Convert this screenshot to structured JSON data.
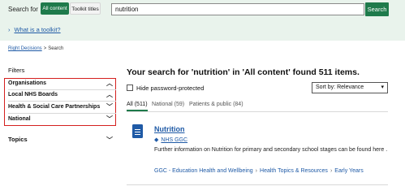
{
  "search": {
    "label": "Search for",
    "tabs": [
      "All content",
      "Toolkit titles"
    ],
    "query": "nutrition",
    "button": "Search",
    "toolkit_link": "What is a toolkit?"
  },
  "breadcrumb": {
    "home": "Right Decisions",
    "sep": ">",
    "current": "Search"
  },
  "filters": {
    "title": "Filters",
    "facets": [
      "Organisations",
      "Local NHS Boards",
      "Health & Social Care Partnerships",
      "National"
    ],
    "topics": "Topics"
  },
  "results": {
    "heading": "Your search for 'nutrition' in 'All content' found 511 items.",
    "hide_label": "Hide password-protected",
    "sort_label": "Sort by:  Relevance",
    "tabs": [
      "All (511)",
      "National (59)",
      "Patients & public (84)"
    ],
    "items": [
      {
        "title": "Nutrition",
        "source": "NHS GGC",
        "description": "Further information on Nutrition for primary and secondary school stages can be found here .",
        "path": [
          "GGC - Education Health and Wellbeing",
          "Health Topics & Resources",
          "Early Years"
        ]
      }
    ]
  },
  "colors": {
    "brand_green": "#1e7a4b",
    "link_blue": "#1f5aa6",
    "highlight_red": "#d4201f",
    "band_bg": "#e9f3ec"
  }
}
